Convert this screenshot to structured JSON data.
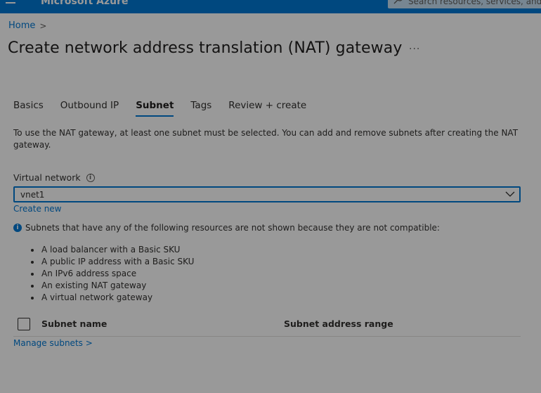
{
  "topbar": {
    "brand": "Microsoft Azure",
    "search_placeholder": "Search resources, services, and docs"
  },
  "breadcrumb": {
    "home": "Home",
    "separator": ">"
  },
  "header": {
    "title": "Create network address translation (NAT) gateway",
    "more": "···"
  },
  "tabs": [
    {
      "label": "Basics",
      "active": false
    },
    {
      "label": "Outbound IP",
      "active": false
    },
    {
      "label": "Subnet",
      "active": true
    },
    {
      "label": "Tags",
      "active": false
    },
    {
      "label": "Review + create",
      "active": false
    }
  ],
  "intro": "To use the NAT gateway, at least one subnet must be selected. You can add and remove subnets after creating the NAT gateway.",
  "virtual_network": {
    "label": "Virtual network",
    "value": "vnet1",
    "create_new": "Create new"
  },
  "notice": {
    "text": "Subnets that have any of the following resources are not shown because they are not compatible:",
    "items": [
      "A load balancer with a Basic SKU",
      "A public IP address with a Basic SKU",
      "An IPv6 address space",
      "An existing NAT gateway",
      "A virtual network gateway"
    ]
  },
  "grid": {
    "col_name": "Subnet name",
    "col_range": "Subnet address range"
  },
  "manage_subnets": "Manage subnets >",
  "colors": {
    "accent": "#0078d4",
    "overlay": "rgba(0,0,0,0.4)"
  }
}
